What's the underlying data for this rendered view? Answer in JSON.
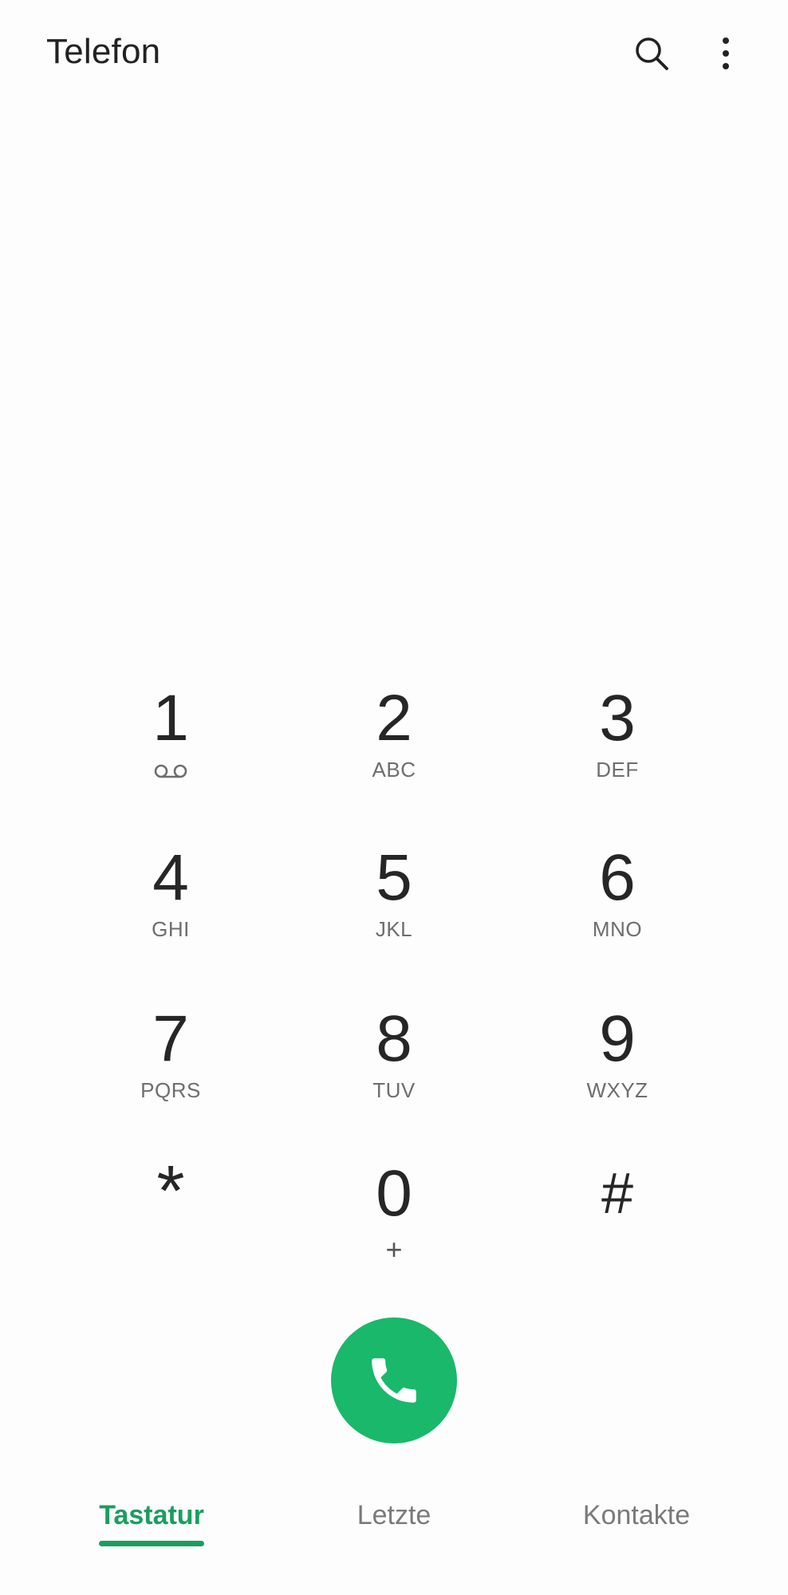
{
  "header": {
    "title": "Telefon",
    "search_icon": "search-icon",
    "menu_icon": "more-vert-icon"
  },
  "keypad": {
    "keys": [
      {
        "digit": "1",
        "letters": "",
        "icon": "voicemail-icon"
      },
      {
        "digit": "2",
        "letters": "ABC"
      },
      {
        "digit": "3",
        "letters": "DEF"
      },
      {
        "digit": "4",
        "letters": "GHI"
      },
      {
        "digit": "5",
        "letters": "JKL"
      },
      {
        "digit": "6",
        "letters": "MNO"
      },
      {
        "digit": "7",
        "letters": "PQRS"
      },
      {
        "digit": "8",
        "letters": "TUV"
      },
      {
        "digit": "9",
        "letters": "WXYZ"
      },
      {
        "digit": "*",
        "letters": ""
      },
      {
        "digit": "0",
        "letters": "+"
      },
      {
        "digit": "#",
        "letters": ""
      }
    ]
  },
  "call_button": {
    "icon": "phone-icon",
    "color": "#19b86a"
  },
  "bottom_nav": {
    "tabs": [
      {
        "label": "Tastatur",
        "active": true
      },
      {
        "label": "Letzte",
        "active": false
      },
      {
        "label": "Kontakte",
        "active": false
      }
    ],
    "accent_color": "#1a9e5f"
  }
}
